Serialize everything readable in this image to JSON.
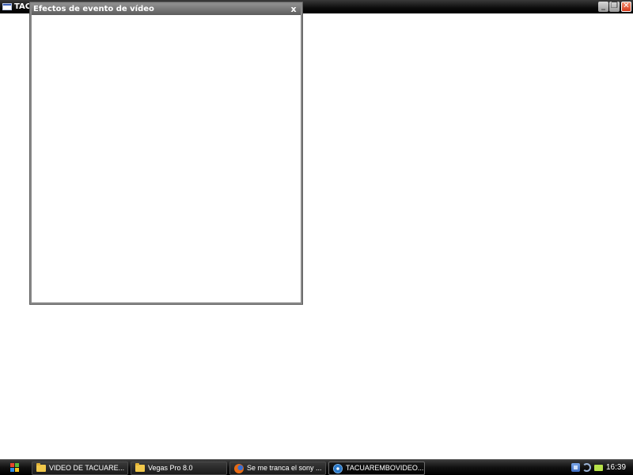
{
  "main_window": {
    "title": "TACUAREMBOVIDEO",
    "minimize_symbol": "_",
    "maximize_symbol": "❐",
    "close_symbol": "✕",
    "icon": "app-window-icon"
  },
  "dialog": {
    "title": "Efectos de evento de vídeo",
    "close_symbol": "x"
  },
  "taskbar": {
    "start_icon": "windows-flag-icon",
    "buttons": [
      {
        "label": "VIDEO DE TACUARE...",
        "icon": "folder-icon",
        "active": false
      },
      {
        "label": "Vegas Pro 8.0",
        "icon": "folder-icon",
        "active": false
      },
      {
        "label": "Se me tranca el sony ...",
        "icon": "firefox-icon",
        "active": false
      },
      {
        "label": "TACUAREMBOVIDEO....",
        "icon": "vegas-icon",
        "active": true
      }
    ],
    "tray": {
      "icons": [
        "network-icon",
        "volume-icon",
        "battery-icon"
      ],
      "clock": "16:39"
    }
  },
  "colors": {
    "titlebar": "#0c0c0c",
    "dialog_titlebar": "#707070",
    "close_button": "#d63a1b",
    "taskbar": "#111111"
  }
}
